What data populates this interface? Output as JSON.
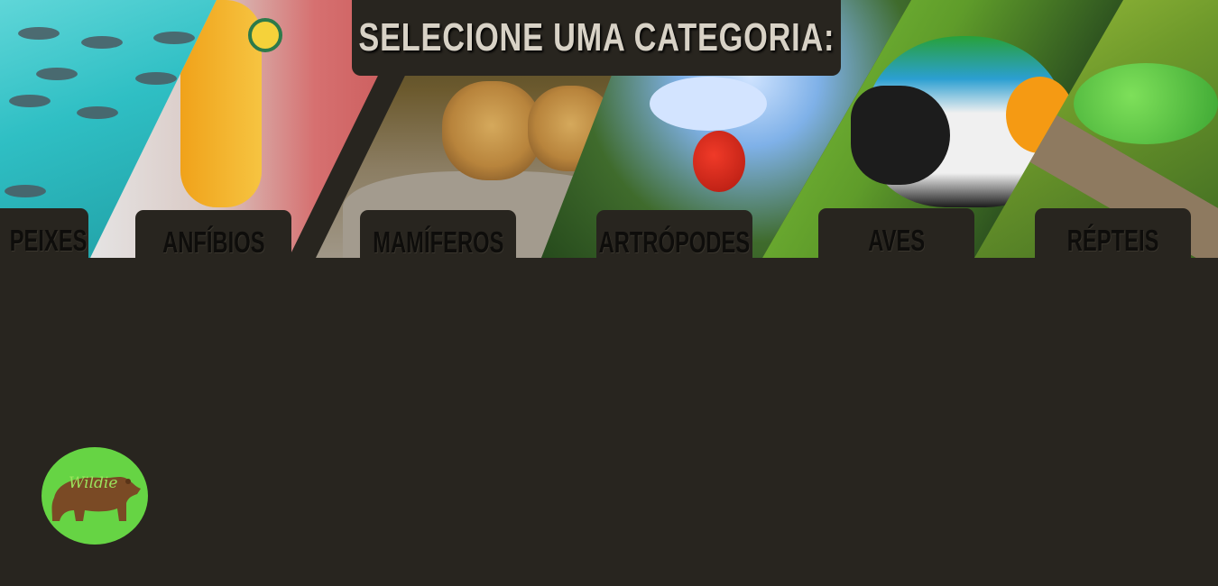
{
  "header": {
    "title": "SELECIONE UMA CATEGORIA:"
  },
  "categories": [
    {
      "label": "PEIXES"
    },
    {
      "label": "ANFÍBIOS"
    },
    {
      "label": "MAMÍFEROS"
    },
    {
      "label": "ARTRÓPODES"
    },
    {
      "label": "AVES"
    },
    {
      "label": "RÉPTEIS"
    }
  ],
  "logo": {
    "text": "Wildie"
  },
  "colors": {
    "background": "#28251f",
    "title_text": "#d8d2c6",
    "logo_circle": "#66d444",
    "bear": "#7a4a25"
  }
}
